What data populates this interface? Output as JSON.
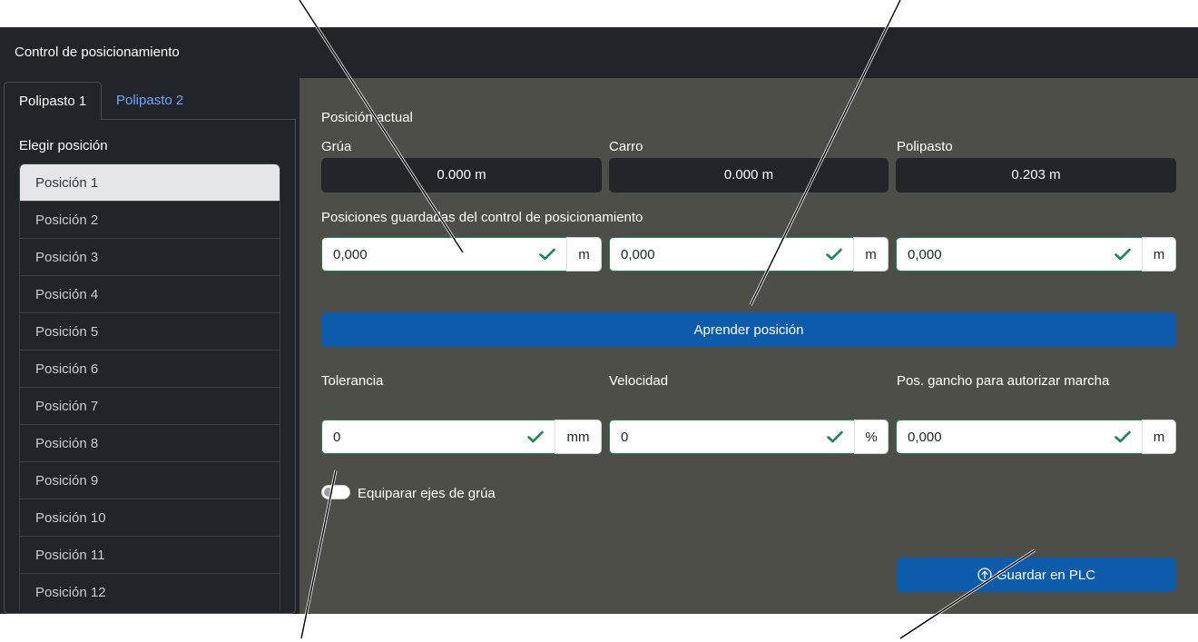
{
  "app": {
    "title": "Control de posicionamiento"
  },
  "tabs": [
    {
      "label": "Polipasto 1",
      "active": true
    },
    {
      "label": "Polipasto 2",
      "active": false
    }
  ],
  "left": {
    "choose_label": "Elegir posición",
    "positions": [
      "Posición 1",
      "Posición 2",
      "Posición 3",
      "Posición 4",
      "Posición 5",
      "Posición 6",
      "Posición 7",
      "Posición 8",
      "Posición 9",
      "Posición 10",
      "Posición 11",
      "Posición 12"
    ],
    "selected_index": 0
  },
  "current": {
    "heading": "Posición actual",
    "crane": {
      "label": "Grúa",
      "value": "0.000 m"
    },
    "trolley": {
      "label": "Carro",
      "value": "0.000 m"
    },
    "hoist": {
      "label": "Polipasto",
      "value": "0.203 m"
    }
  },
  "saved": {
    "heading": "Posiciones guardadas del control de posicionamiento",
    "fields": [
      {
        "value": "0,000",
        "unit": "m"
      },
      {
        "value": "0,000",
        "unit": "m"
      },
      {
        "value": "0,000",
        "unit": "m"
      }
    ],
    "learn_button": "Aprender posición"
  },
  "params": {
    "tolerance": {
      "label": "Tolerancia",
      "value": "0",
      "unit": "mm"
    },
    "speed": {
      "label": "Velocidad",
      "value": "0",
      "unit": "%"
    },
    "hook": {
      "label": "Pos. gancho para autorizar marcha",
      "value": "0,000",
      "unit": "m"
    }
  },
  "toggle": {
    "label": "Equiparar ejes de grúa",
    "on": false
  },
  "save_button": "Guardar en PLC",
  "colors": {
    "valid": "#198754",
    "primary": "#0d5cab",
    "panel": "#4d4e48",
    "dark": "#212429"
  }
}
